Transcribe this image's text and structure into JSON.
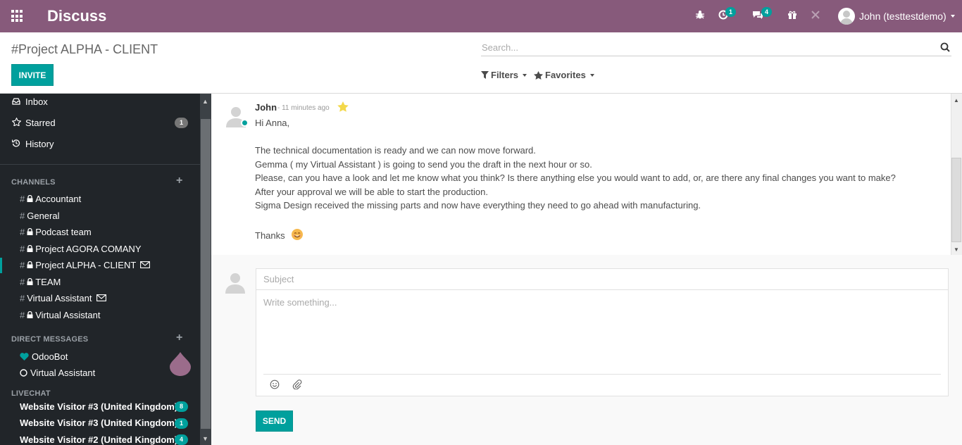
{
  "navbar": {
    "app_title": "Discuss",
    "activity_badge": "1",
    "messages_badge": "4",
    "user_name": "John (testtestdemo)",
    "bg_color": "#875a7b"
  },
  "control_panel": {
    "breadcrumb": "#Project ALPHA - CLIENT",
    "invite_label": "INVITE",
    "search_placeholder": "Search...",
    "filters_label": "Filters",
    "favorites_label": "Favorites"
  },
  "sidebar": {
    "mailboxes": [
      {
        "label": "Inbox",
        "icon": "inbox-icon"
      },
      {
        "label": "Starred",
        "icon": "star-outline-icon",
        "count": "1"
      },
      {
        "label": "History",
        "icon": "history-icon"
      }
    ],
    "channels_header": "CHANNELS",
    "channels": [
      {
        "label": "Accountant",
        "private": true
      },
      {
        "label": "General",
        "private": false
      },
      {
        "label": "Podcast team",
        "private": true
      },
      {
        "label": "Project AGORA COMANY",
        "private": true
      },
      {
        "label": "Project ALPHA - CLIENT",
        "private": true,
        "active": true,
        "envelope": true
      },
      {
        "label": "TEAM",
        "private": true
      },
      {
        "label": "Virtual Assistant",
        "private": false,
        "envelope": true
      },
      {
        "label": "Virtual Assistant",
        "private": true
      }
    ],
    "dm_header": "DIRECT MESSAGES",
    "direct_messages": [
      {
        "label": "OdooBot",
        "icon": "heart-icon"
      },
      {
        "label": "Virtual Assistant",
        "icon": "offline-circle-icon"
      }
    ],
    "livechat_header": "LIVECHAT",
    "livechat": [
      {
        "label": "Website Visitor #3 (United Kingdom)",
        "count": "8"
      },
      {
        "label": "Website Visitor #3 (United Kingdom)",
        "count": "1"
      },
      {
        "label": "Website Visitor #2 (United Kingdom)",
        "count": "4"
      }
    ]
  },
  "message": {
    "author": "John",
    "timestamp": "- 11 minutes ago",
    "lines": [
      "Hi Anna,",
      "The technical documentation is ready and we can now move forward.",
      "Gemma ( my Virtual Assistant ) is going to send you the draft in the next hour or so.",
      "Please, can you have a look and let me know what you think? Is there anything else you would want to add, or, are there any final changes you want to make?",
      "After your approval we will be  able to start the production.",
      "Sigma Design received the missing parts and now have everything they need to go ahead with manufacturing.",
      "Thanks"
    ]
  },
  "composer": {
    "subject_placeholder": "Subject",
    "body_placeholder": "Write something...",
    "send_label": "SEND"
  },
  "colors": {
    "accent": "#00a09d",
    "sidebar_bg": "#212529"
  }
}
